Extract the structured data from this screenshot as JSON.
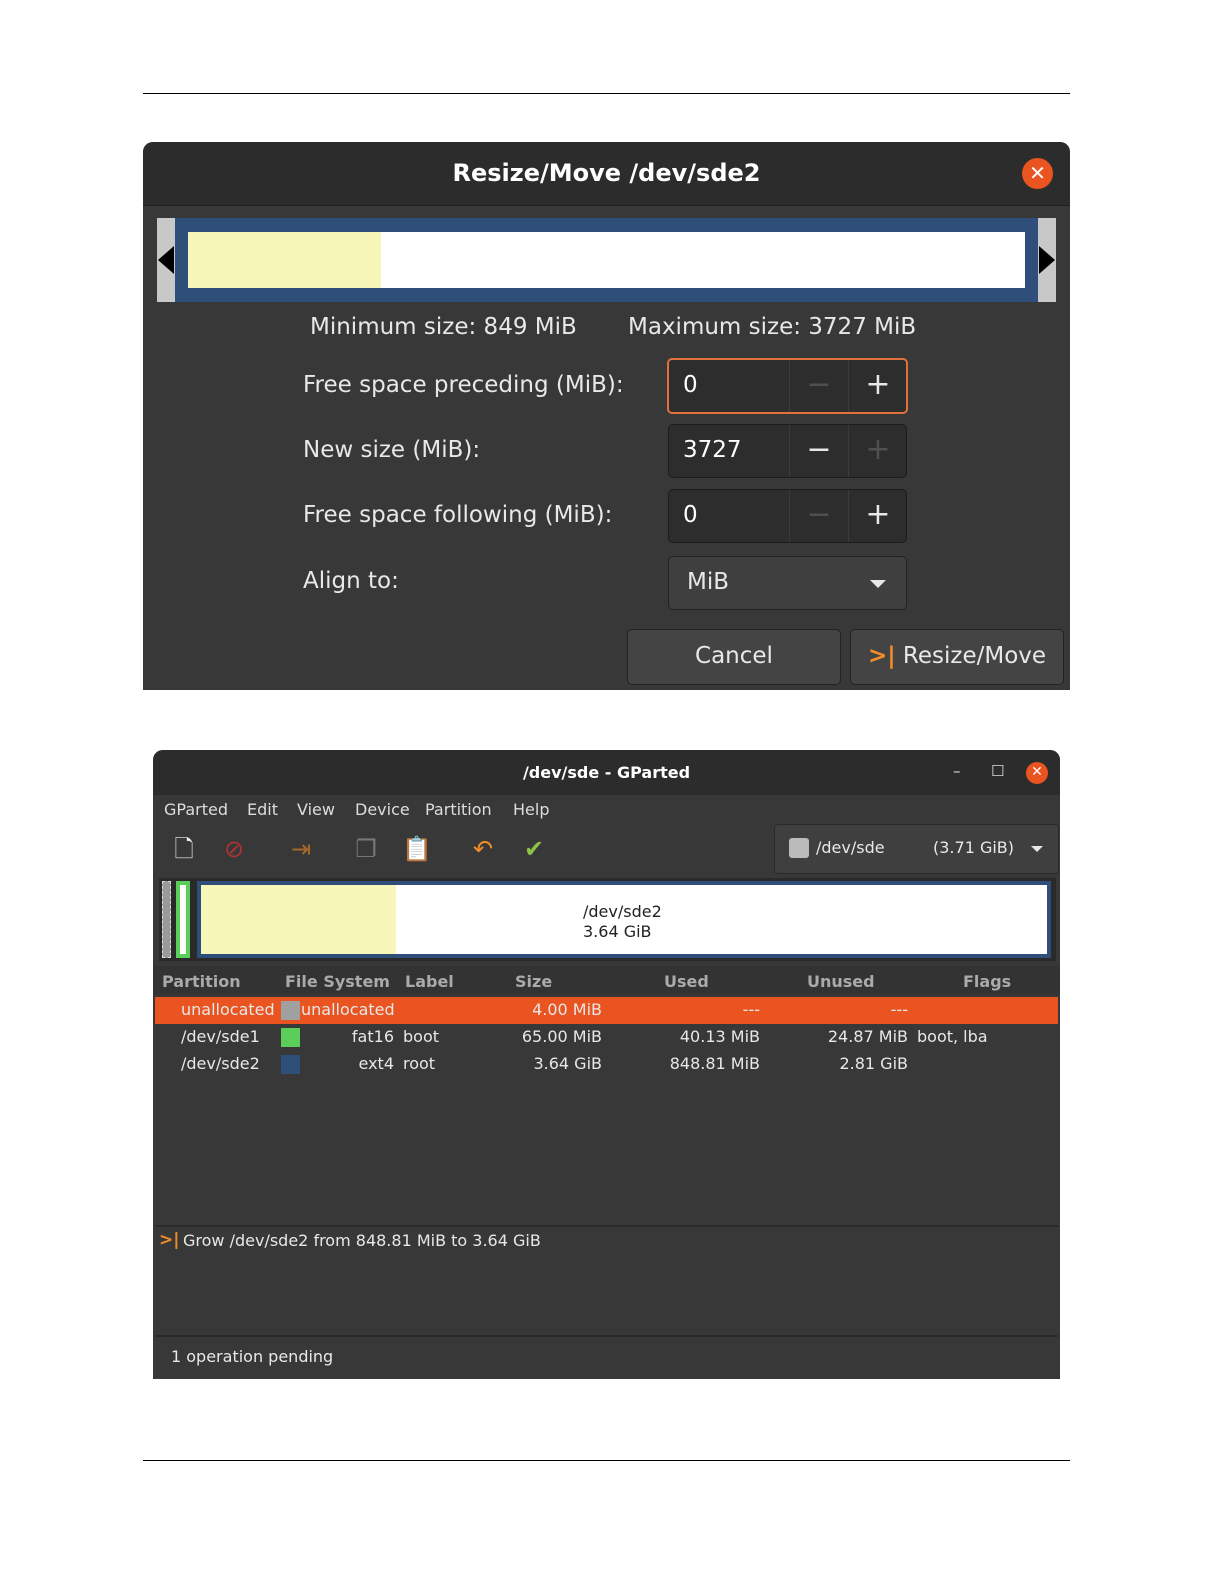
{
  "dialog": {
    "title": "Resize/Move /dev/sde2",
    "used_fraction": 0.23,
    "min_size": "Minimum size: 849 MiB",
    "max_size": "Maximum size: 3727 MiB",
    "fields": [
      {
        "label": "Free space preceding (MiB):",
        "value": "0",
        "minus_enabled": false,
        "plus_enabled": true
      },
      {
        "label": "New size (MiB):",
        "value": "3727",
        "minus_enabled": true,
        "plus_enabled": false
      },
      {
        "label": "Free space following (MiB):",
        "value": "0",
        "minus_enabled": false,
        "plus_enabled": true
      }
    ],
    "align_label": "Align to:",
    "align_value": "MiB",
    "cancel_label": "Cancel",
    "resize_label": "Resize/Move"
  },
  "gparted": {
    "title": "/dev/sde - GParted",
    "menu": [
      "GParted",
      "Edit",
      "View",
      "Device",
      "Partition",
      "Help"
    ],
    "toolbar_icons": [
      "new-icon",
      "delete-icon",
      "resize-move-icon",
      "copy-icon",
      "paste-icon",
      "undo-icon",
      "apply-icon"
    ],
    "device": {
      "name": "/dev/sde",
      "size": "(3.71 GiB)"
    },
    "map": {
      "name": "/dev/sde2",
      "size": "3.64 GiB",
      "used_fraction": 0.23
    },
    "columns": [
      "Partition",
      "File System",
      "Label",
      "Size",
      "Used",
      "Unused",
      "Flags"
    ],
    "rows": [
      {
        "partition": "unallocated",
        "fs": "unallocated",
        "label": "",
        "size": "4.00 MiB",
        "used": "---",
        "unused": "---",
        "flags": "",
        "color": "#a0a0a0",
        "selected": true
      },
      {
        "partition": "/dev/sde1",
        "fs": "fat16",
        "label": "boot",
        "size": "65.00 MiB",
        "used": "40.13 MiB",
        "unused": "24.87 MiB",
        "flags": "boot, lba",
        "color": "#5acd5a",
        "selected": false
      },
      {
        "partition": "/dev/sde2",
        "fs": "ext4",
        "label": "root",
        "size": "3.64 GiB",
        "used": "848.81 MiB",
        "unused": "2.81 GiB",
        "flags": "",
        "color": "#2f4e7a",
        "selected": false
      }
    ],
    "operation": "Grow /dev/sde2 from 848.81 MiB to 3.64 GiB",
    "status": "1 operation pending"
  }
}
